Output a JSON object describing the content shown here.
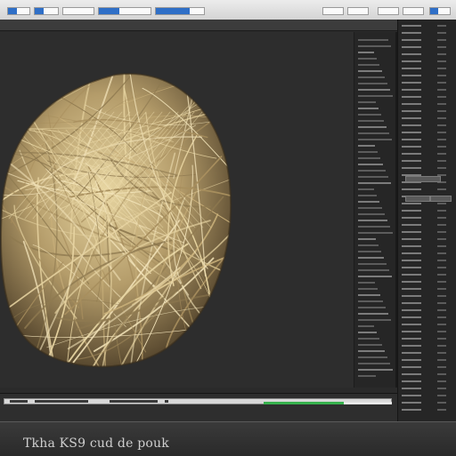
{
  "colors": {
    "accent": "#2f6fc7",
    "ball": "#b49c6a",
    "ball_highlight": "#e8d6a2",
    "timeline_green": "#37b24d"
  },
  "footer": {
    "caption": "Tkha KS9 cud de pouk"
  },
  "object": {
    "name": "fiber-ball-mesh"
  }
}
